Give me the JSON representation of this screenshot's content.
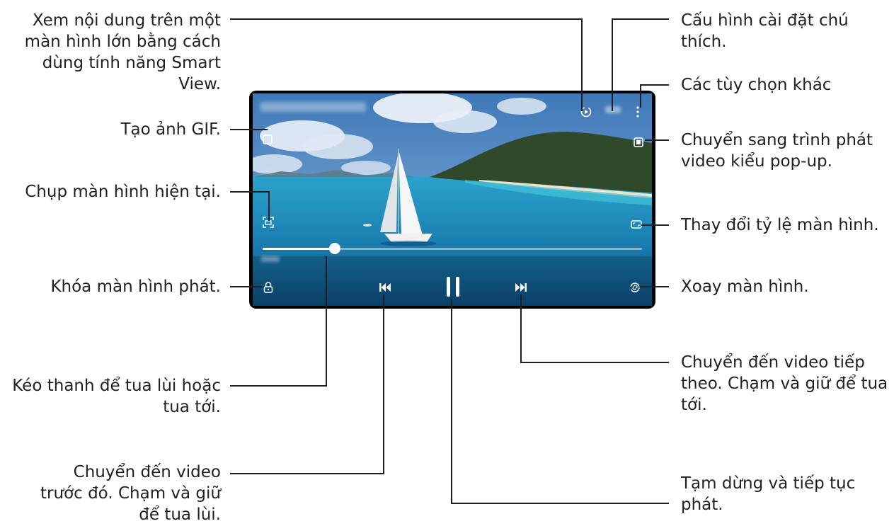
{
  "labels": {
    "smart_view": "Xem nội dung trên một\nmàn hình lớn bằng cách\ndùng tính năng Smart\nView.",
    "gif": "Tạo ảnh GIF.",
    "capture": "Chụp màn hình hiện tại.",
    "lock": "Khóa màn hình phát.",
    "seek": "Kéo thanh để tua lùi hoặc\ntua tới.",
    "previous": "Chuyển đến video\ntrước đó. Chạm và giữ\nđể tua lùi.",
    "subtitle": "Cấu hình cài đặt chú\nthích.",
    "more": "Các tùy chọn khác",
    "popup": "Chuyển sang trình phát\nvideo kiểu pop-up.",
    "ratio": "Thay đổi tỷ lệ màn hình.",
    "rotate": "Xoay màn hình.",
    "next": "Chuyển đến video tiếp\ntheo. Chạm và giữ để tua\ntới.",
    "pause": "Tạm dừng và tiếp tục\nphát."
  },
  "player": {
    "progress": 0.19,
    "icons": [
      "smart-view-icon",
      "subtitle-icon",
      "more-options-icon",
      "gif-icon",
      "popup-player-icon",
      "capture-icon",
      "screen-ratio-icon",
      "lock-icon",
      "previous-icon",
      "pause-icon",
      "next-icon",
      "rotate-icon"
    ]
  },
  "colors": {
    "text": "#231f20",
    "sky": "#5d93c9",
    "sea": "#1f86b8",
    "island": "#2e4a2a",
    "frame": "#000000"
  }
}
